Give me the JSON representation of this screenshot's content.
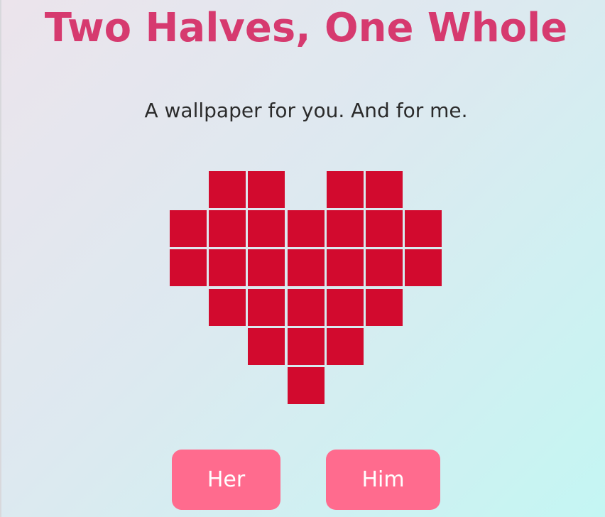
{
  "title": "Two Halves, One Whole",
  "subtitle": "A wallpaper for you. And for me.",
  "heart": {
    "color": "#d20a2e",
    "grid": [
      [
        0,
        1,
        1,
        0,
        1,
        1,
        0
      ],
      [
        1,
        1,
        1,
        1,
        1,
        1,
        1
      ],
      [
        1,
        1,
        1,
        1,
        1,
        1,
        1
      ],
      [
        0,
        1,
        1,
        1,
        1,
        1,
        0
      ],
      [
        0,
        0,
        1,
        1,
        1,
        0,
        0
      ],
      [
        0,
        0,
        0,
        1,
        0,
        0,
        0
      ]
    ]
  },
  "buttons": {
    "her_label": "Her",
    "him_label": "Him",
    "color": "#ff6b8e"
  }
}
